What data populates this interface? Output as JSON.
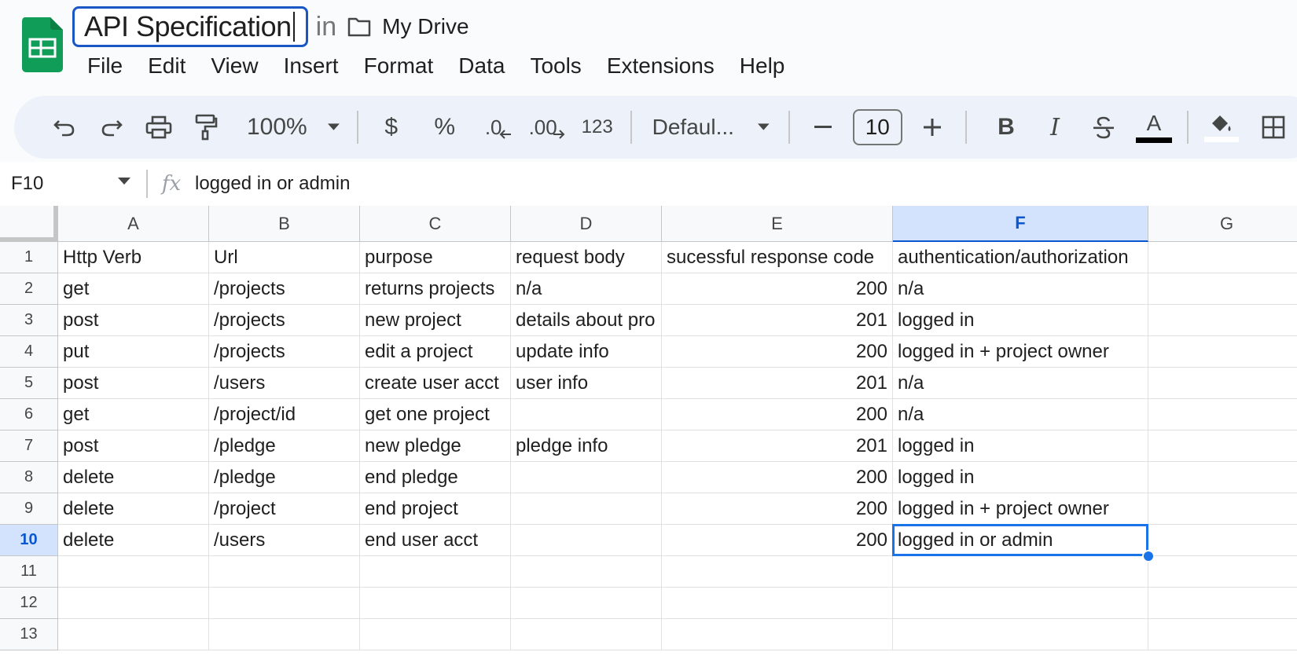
{
  "document": {
    "title": "API Specification",
    "in_label": "in",
    "location": "My Drive"
  },
  "menu": [
    "File",
    "Edit",
    "View",
    "Insert",
    "Format",
    "Data",
    "Tools",
    "Extensions",
    "Help"
  ],
  "toolbar": {
    "zoom": "100%",
    "currency": "$",
    "percent": "%",
    "decrease_decimal": ".0",
    "increase_decimal": ".00",
    "more_formats": "123",
    "font": "Defaul...",
    "font_size": "10",
    "bold": "B",
    "italic": "I",
    "text_color_label": "A",
    "text_color": "#000000",
    "fill_color": "#ffffff"
  },
  "formula_bar": {
    "cell_ref": "F10",
    "fx": "fx",
    "content": "logged in or admin"
  },
  "sheet": {
    "columns": [
      "A",
      "B",
      "C",
      "D",
      "E",
      "F",
      "G"
    ],
    "selected_column": "F",
    "selected_row": "10",
    "row_numbers": [
      "1",
      "2",
      "3",
      "4",
      "5",
      "6",
      "7",
      "8",
      "9",
      "10",
      "11",
      "12",
      "13"
    ],
    "rows": [
      [
        "Http Verb",
        "Url",
        "purpose",
        "request body",
        "sucessful response code",
        "authentication/authorization"
      ],
      [
        "get",
        "/projects",
        "returns projects",
        "n/a",
        "200",
        "n/a"
      ],
      [
        "post",
        "/projects",
        "new project",
        "details about pro",
        "201",
        "logged in"
      ],
      [
        "put",
        "/projects",
        "edit a project",
        "update info",
        "200",
        "logged in + project owner"
      ],
      [
        "post",
        "/users",
        "create user acct",
        "user info",
        "201",
        "n/a"
      ],
      [
        "get",
        "/project/id",
        "get one project",
        "",
        "200",
        "n/a"
      ],
      [
        "post",
        "/pledge",
        "new pledge",
        "pledge info",
        "201",
        "logged in"
      ],
      [
        "delete",
        "/pledge",
        "end pledge",
        "",
        "200",
        "logged in"
      ],
      [
        "delete",
        "/project",
        "end project",
        "",
        "200",
        "logged in + project owner"
      ],
      [
        "delete",
        "/users",
        "end user acct",
        "",
        "200",
        "logged in or admin"
      ],
      [
        "",
        "",
        "",
        "",
        "",
        ""
      ],
      [
        "",
        "",
        "",
        "",
        "",
        ""
      ],
      [
        "",
        "",
        "",
        "",
        "",
        ""
      ]
    ]
  },
  "colors": {
    "accent": "#1a73e8",
    "sheets_green": "#0f9d58"
  }
}
